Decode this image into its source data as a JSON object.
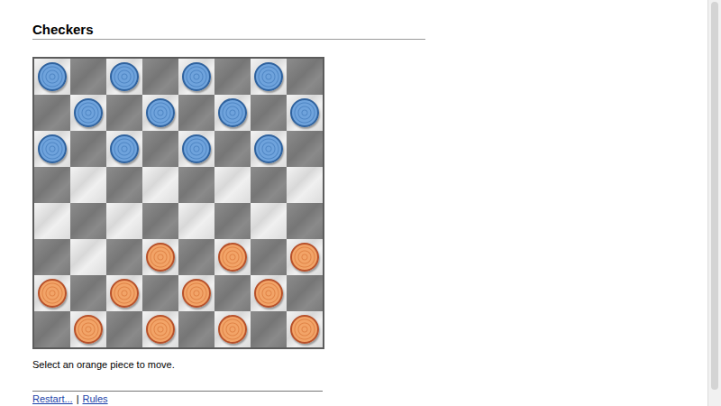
{
  "page": {
    "title": "Checkers"
  },
  "board": {
    "rows": [
      [
        "blue",
        "empty",
        "blue",
        "empty",
        "blue",
        "empty",
        "blue",
        "empty"
      ],
      [
        "empty",
        "blue",
        "empty",
        "blue",
        "empty",
        "blue",
        "empty",
        "blue"
      ],
      [
        "blue",
        "empty",
        "blue",
        "empty",
        "blue",
        "empty",
        "blue",
        "empty"
      ],
      [
        "empty",
        "empty",
        "empty",
        "empty",
        "empty",
        "empty",
        "empty",
        "empty"
      ],
      [
        "empty",
        "empty",
        "empty",
        "empty",
        "empty",
        "empty",
        "empty",
        "empty"
      ],
      [
        "empty",
        "empty",
        "empty",
        "orange",
        "empty",
        "orange",
        "empty",
        "orange"
      ],
      [
        "orange",
        "empty",
        "orange",
        "empty",
        "orange",
        "empty",
        "orange",
        "empty"
      ],
      [
        "empty",
        "orange",
        "empty",
        "orange",
        "empty",
        "orange",
        "empty",
        "orange"
      ]
    ]
  },
  "status": "Select an orange piece to move.",
  "links": [
    "Restart...",
    "Rules"
  ],
  "separator": "|"
}
